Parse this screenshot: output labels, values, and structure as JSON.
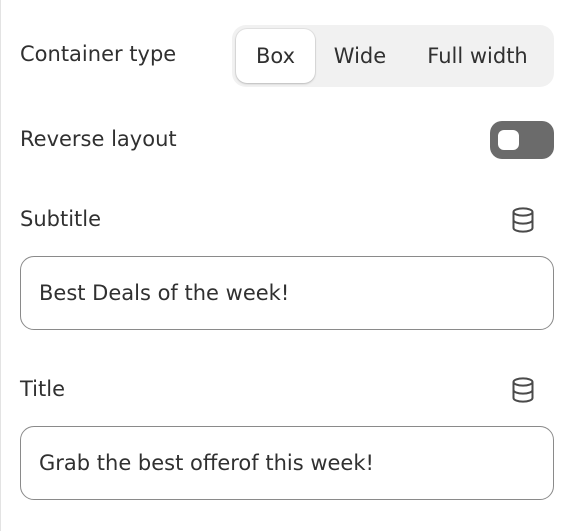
{
  "container_type": {
    "label": "Container type",
    "options": [
      "Box",
      "Wide",
      "Full width"
    ],
    "selected": "Box"
  },
  "reverse_layout": {
    "label": "Reverse layout",
    "enabled": false
  },
  "subtitle": {
    "label": "Subtitle",
    "value": "Best Deals of the week!",
    "icon": "database-icon"
  },
  "title": {
    "label": "Title",
    "value": "Grab the best offerof this week!",
    "icon": "database-icon"
  },
  "colors": {
    "toggle_off": "#6b6b6b",
    "segment_bg": "#f1f1f1",
    "field_border": "#8a8a8a"
  }
}
